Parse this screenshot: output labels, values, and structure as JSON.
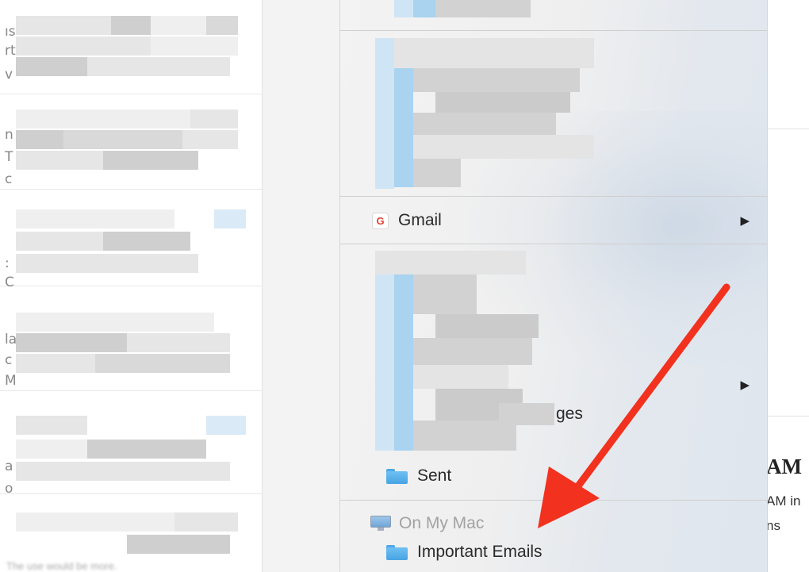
{
  "left_pane": {
    "edge_glyphs": [
      "ıs",
      "rt",
      "v",
      "n",
      "T",
      "c",
      ":",
      "C",
      "la",
      "c",
      "M",
      "a",
      "o"
    ],
    "bottom_text": "The use would be more."
  },
  "menu": {
    "gmail": {
      "label": "Gmail",
      "logo_letter": "G",
      "submenu_arrow": "▶"
    },
    "blurred_item": {
      "partial_label": "ges",
      "submenu_arrow": "▶"
    },
    "sent": {
      "label": "Sent"
    },
    "on_my_mac": {
      "label": "On My Mac"
    },
    "important_emails": {
      "label": "Important Emails"
    }
  },
  "right_pane": {
    "heading_fragment": "AM",
    "line1_fragment": "AM in",
    "line2_fragment": "ns"
  },
  "colors": {
    "folder_blue": "#48a4e3",
    "annotation_red": "#f2311f",
    "section_header_gray": "#a2a2a2"
  }
}
